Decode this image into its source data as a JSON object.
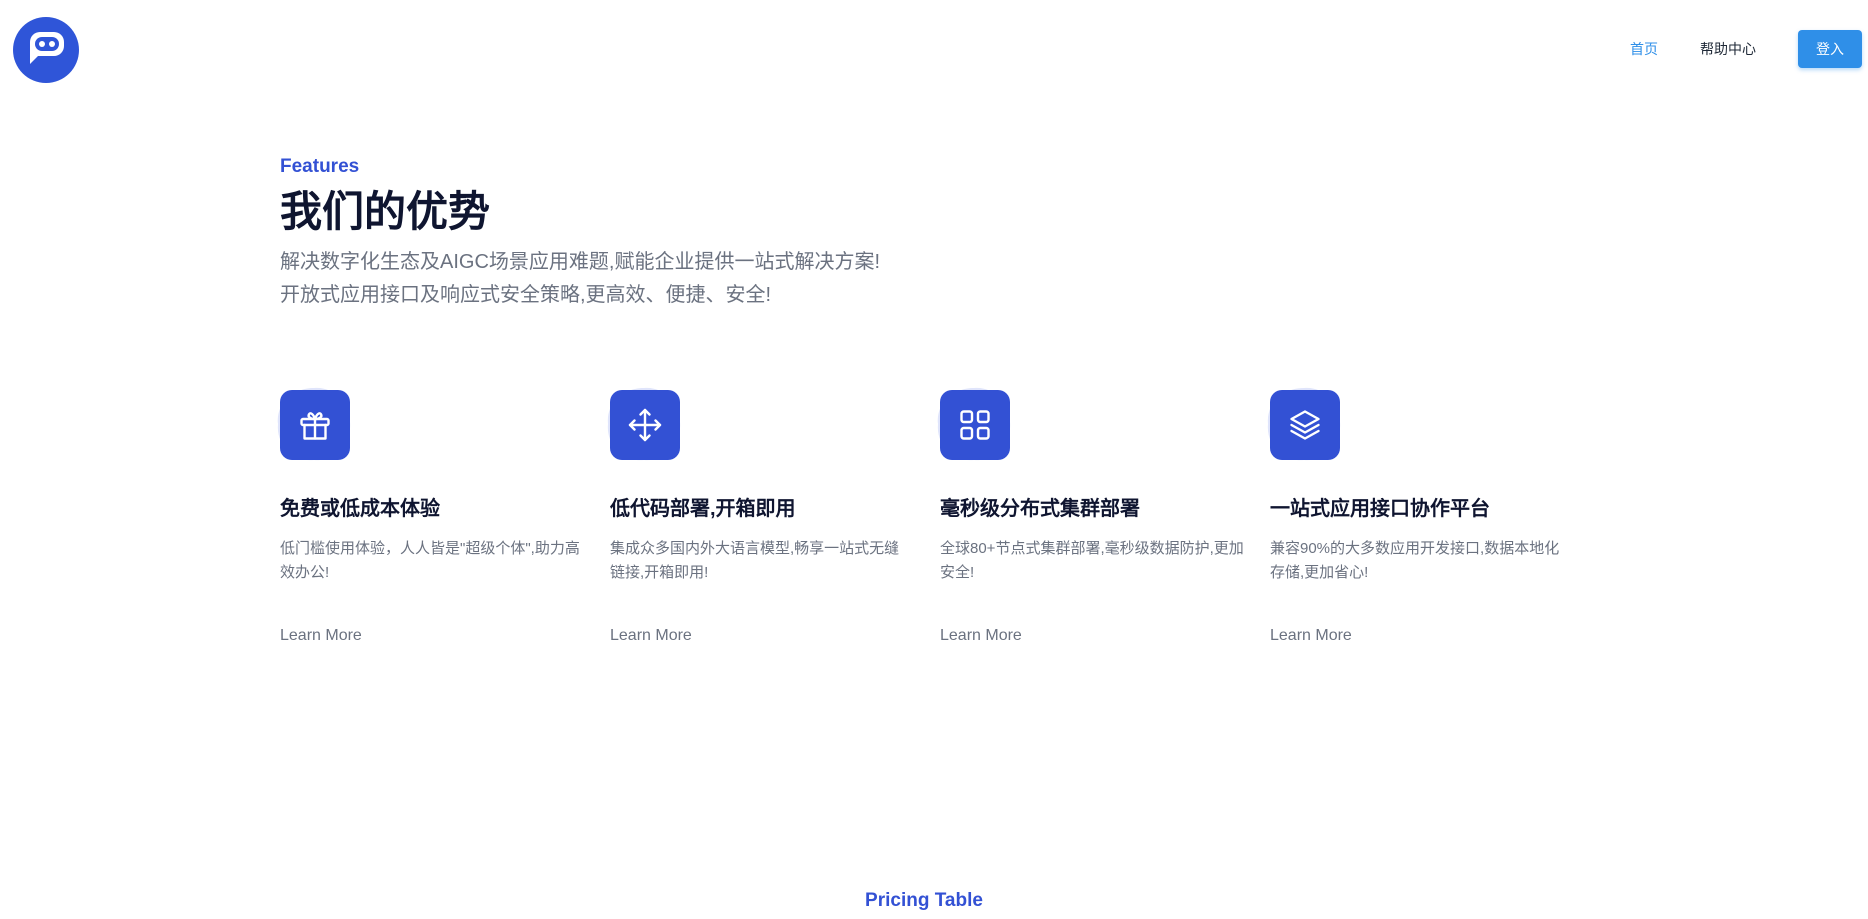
{
  "header": {
    "nav": [
      {
        "label": "首页",
        "active": true
      },
      {
        "label": "帮助中心",
        "active": false
      }
    ],
    "login_label": "登入"
  },
  "features_section": {
    "eyebrow": "Features",
    "title": "我们的优势",
    "subtitle_line1": "解决数字化生态及AIGC场景应用难题,赋能企业提供一站式解决方案!",
    "subtitle_line2": "开放式应用接口及响应式安全策略,更高效、便捷、安全!",
    "items": [
      {
        "icon": "gift-icon",
        "title": "免费或低成本体验",
        "desc": "低门槛使用体验，人人皆是\"超级个体\",助力高效办公!",
        "link": "Learn More"
      },
      {
        "icon": "move-icon",
        "title": "低代码部署,开箱即用",
        "desc": "集成众多国内外大语言模型,畅享一站式无缝链接,开箱即用!",
        "link": "Learn More"
      },
      {
        "icon": "grid-icon",
        "title": "毫秒级分布式集群部署",
        "desc": "全球80+节点式集群部署,毫秒级数据防护,更加安全!",
        "link": "Learn More"
      },
      {
        "icon": "layers-icon",
        "title": "一站式应用接口协作平台",
        "desc": "兼容90%的大多数应用开发接口,数据本地化存储,更加省心!",
        "link": "Learn More"
      }
    ]
  },
  "pricing": {
    "label": "Pricing Table"
  },
  "colors": {
    "brand": "#3351d4",
    "nav_active": "#2f8fe8",
    "heading": "#0f1530",
    "muted": "#6b7280"
  }
}
